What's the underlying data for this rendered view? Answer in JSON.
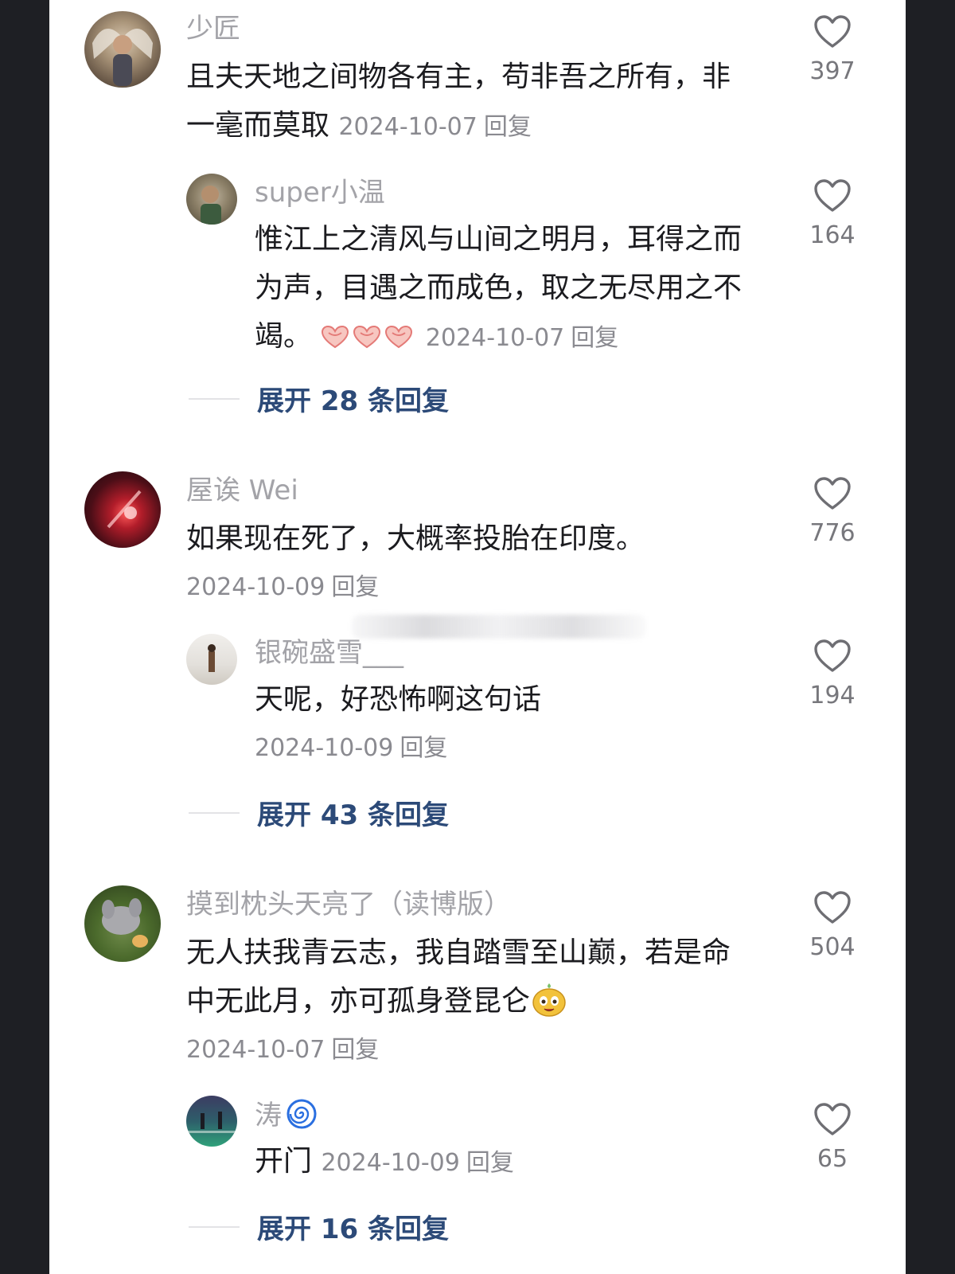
{
  "comments": [
    {
      "username": "少匠",
      "text_lines": [
        "且夫天地之间物各有主，苟非吾之所有，非",
        "一毫而莫取"
      ],
      "date": "2024-10-07",
      "reply_label": "回复",
      "likes": "397",
      "reply": {
        "username": "super小温",
        "text_lines": [
          "惟江上之清风与山间之明月，耳得之而",
          "为声，目遇之而成色，取之无尽用之不",
          "竭。"
        ],
        "date": "2024-10-07",
        "reply_label": "回复",
        "likes": "164"
      },
      "expand_label": "展开 28 条回复"
    },
    {
      "username": "屋诶 Wei",
      "text_lines": [
        "如果现在死了，大概率投胎在印度。"
      ],
      "date": "2024-10-09",
      "reply_label": "回复",
      "likes": "776",
      "reply": {
        "username": "银碗盛雪___",
        "text_lines": [
          "天呢，好恐怖啊这句话"
        ],
        "date": "2024-10-09",
        "reply_label": "回复",
        "likes": "194"
      },
      "expand_label": "展开 43 条回复"
    },
    {
      "username": "摸到枕头天亮了（读博版）",
      "text_lines": [
        "无人扶我青云志，我自踏雪至山巅，若是命",
        "中无此月，亦可孤身登昆仑"
      ],
      "date": "2024-10-07",
      "reply_label": "回复",
      "likes": "504",
      "reply": {
        "username": "涛",
        "text_lines": [
          "开门"
        ],
        "date": "2024-10-09",
        "reply_label": "回复",
        "likes": "65"
      },
      "expand_label": "展开 16 条回复"
    }
  ],
  "icons": {
    "like": "heart-outline-icon",
    "emoji_hearts": "heart-hands-emoji",
    "emoji_smiley": "smiley-emoji",
    "spiral": "cyclone-emoji"
  },
  "colors": {
    "link": "#2c4a78",
    "muted": "#a3a3a8",
    "text": "#1b1b1f"
  }
}
